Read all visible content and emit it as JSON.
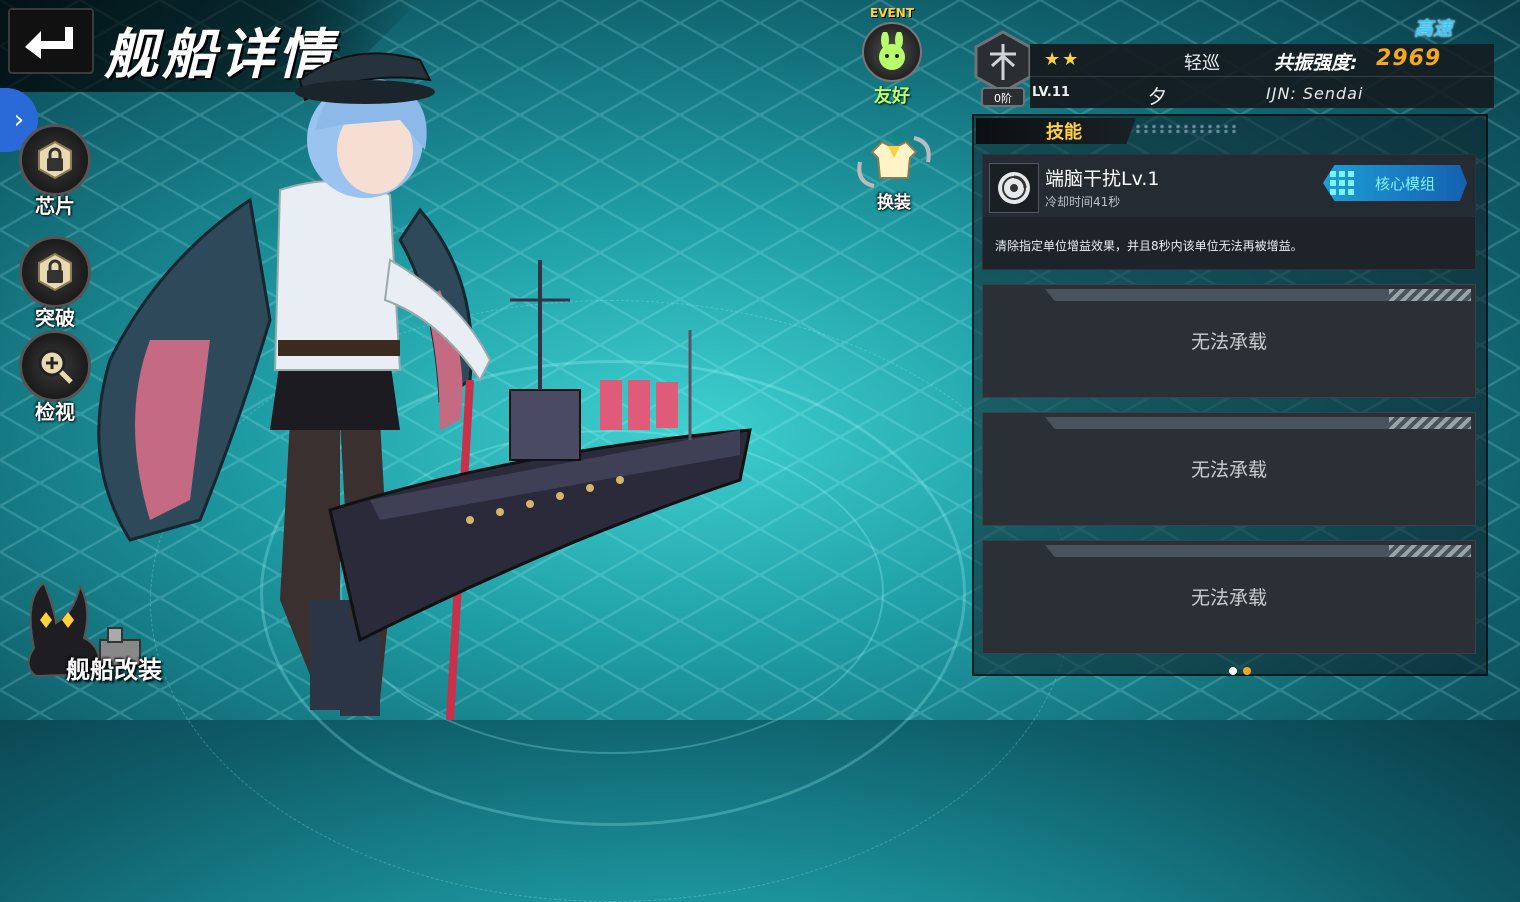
{
  "header": {
    "title": "舰船详情",
    "back_label": "back"
  },
  "side_menu": {
    "expand_icon": "chevron-right-icon",
    "items": [
      {
        "label": "芯片",
        "icon": "lock-icon"
      },
      {
        "label": "突破",
        "icon": "lock-icon"
      },
      {
        "label": "检视",
        "icon": "zoom-in-icon"
      }
    ],
    "remodel_label": "舰船改装"
  },
  "event": {
    "tag": "EVENT",
    "status": "友好",
    "icon": "bunny-face-icon"
  },
  "costume": {
    "label": "换装",
    "icon": "outfit-icon"
  },
  "ship_info": {
    "speed": "高速",
    "rank": "0阶",
    "stars": "★★",
    "type": "轻巡",
    "resonance_label": "共振强度:",
    "resonance_value": "2969",
    "level": "LV.11",
    "name": "夕",
    "code": "IJN: Sendai"
  },
  "panel": {
    "tab_label": "技能",
    "skill": {
      "name": "端脑干扰Lv.1",
      "cooldown": "冷却时间41秒",
      "core_button": "核心模组",
      "description": "清除指定单位增益效果，并且8秒内该单位无法再被增益。"
    },
    "slots": [
      "无法承载",
      "无法承载",
      "无法承载"
    ],
    "page_count": 2,
    "current_page": 1
  },
  "colors": {
    "accent_gold": "#f4a81a",
    "star_yellow": "#ffd23c",
    "core_blue": "#1d9fd6",
    "friendly_green": "#b6ff6a"
  }
}
